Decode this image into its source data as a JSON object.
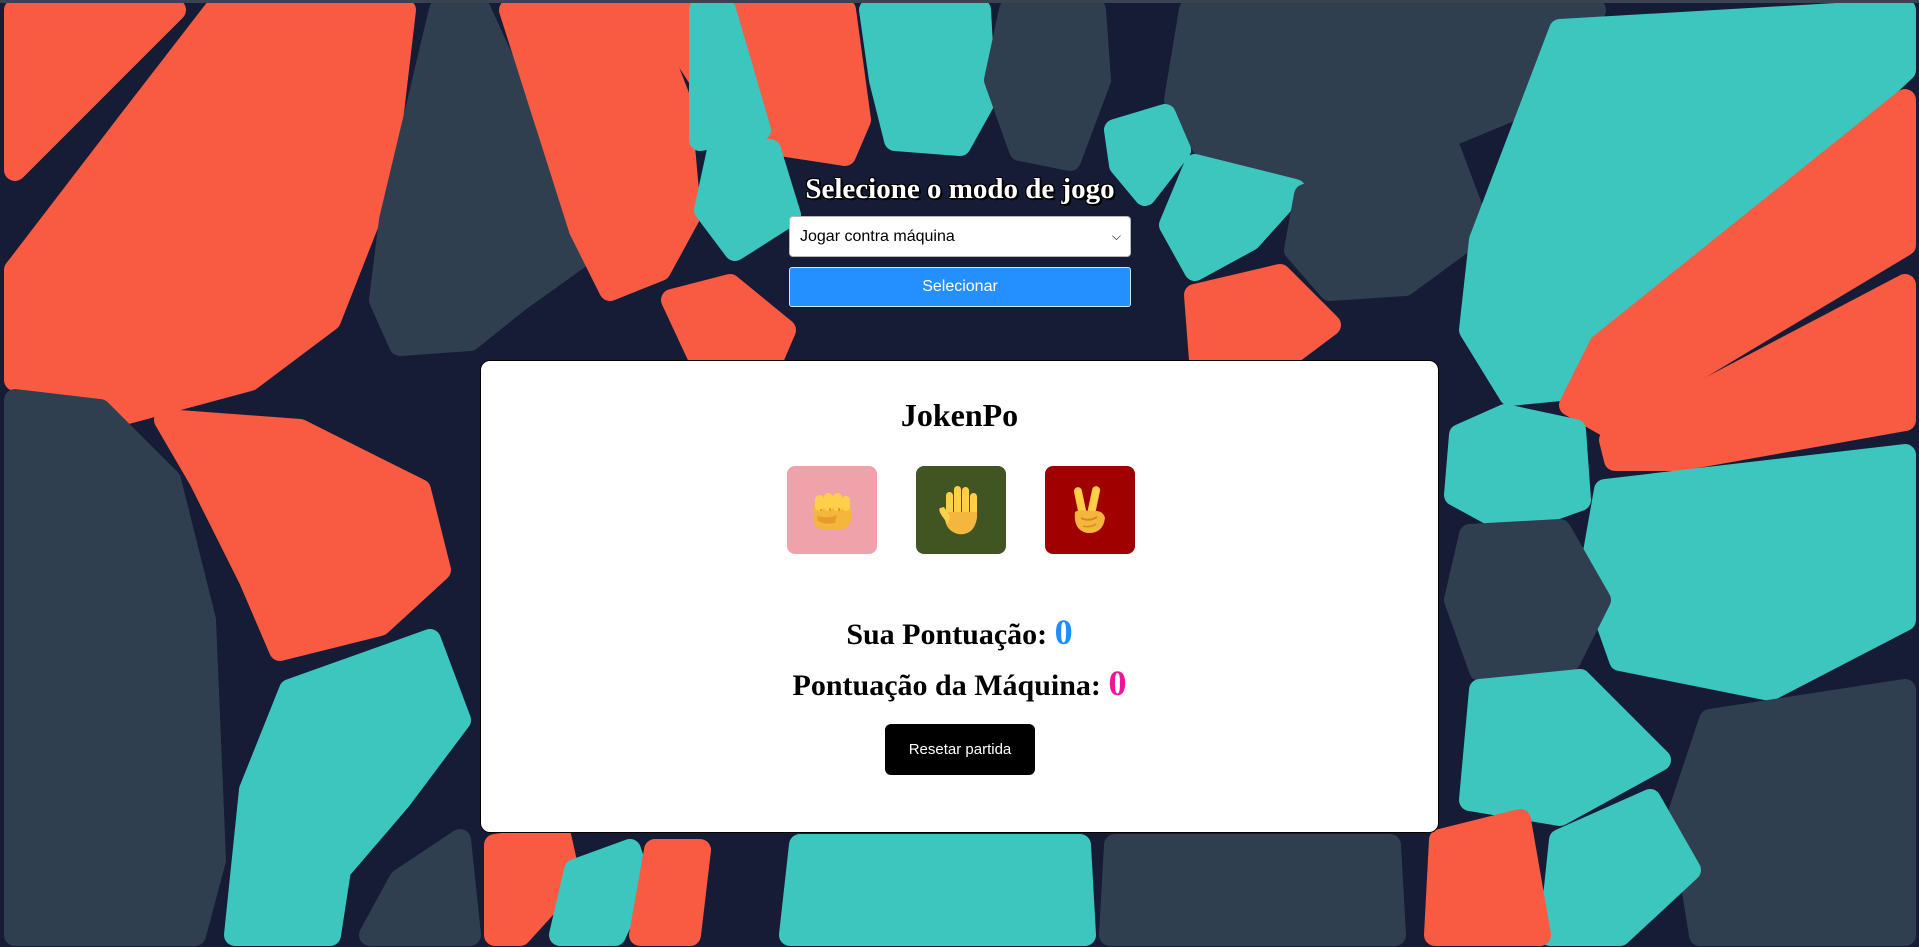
{
  "mode_selector": {
    "title": "Selecione o modo de jogo",
    "selected_option": "Jogar contra máquina",
    "button_label": "Selecionar"
  },
  "game": {
    "title": "JokenPo",
    "choices": [
      {
        "name": "rock",
        "icon": "fist-hand-icon",
        "color": "#f0a2aa"
      },
      {
        "name": "paper",
        "icon": "raised-hand-icon",
        "color": "#415522"
      },
      {
        "name": "scissors",
        "icon": "victory-hand-icon",
        "color": "#a00000"
      }
    ],
    "player_score_label": "Sua Pontuação:",
    "player_score": "0",
    "machine_score_label": "Pontuação da Máquina:",
    "machine_score": "0",
    "reset_label": "Resetar partida"
  },
  "colors": {
    "background": "#161b36",
    "shape_red": "#f85a42",
    "shape_teal": "#3dc6be",
    "shape_slate": "#303f50",
    "button_blue": "#2490ff",
    "player_score": "#1f8cff",
    "machine_score": "#f0149b"
  }
}
